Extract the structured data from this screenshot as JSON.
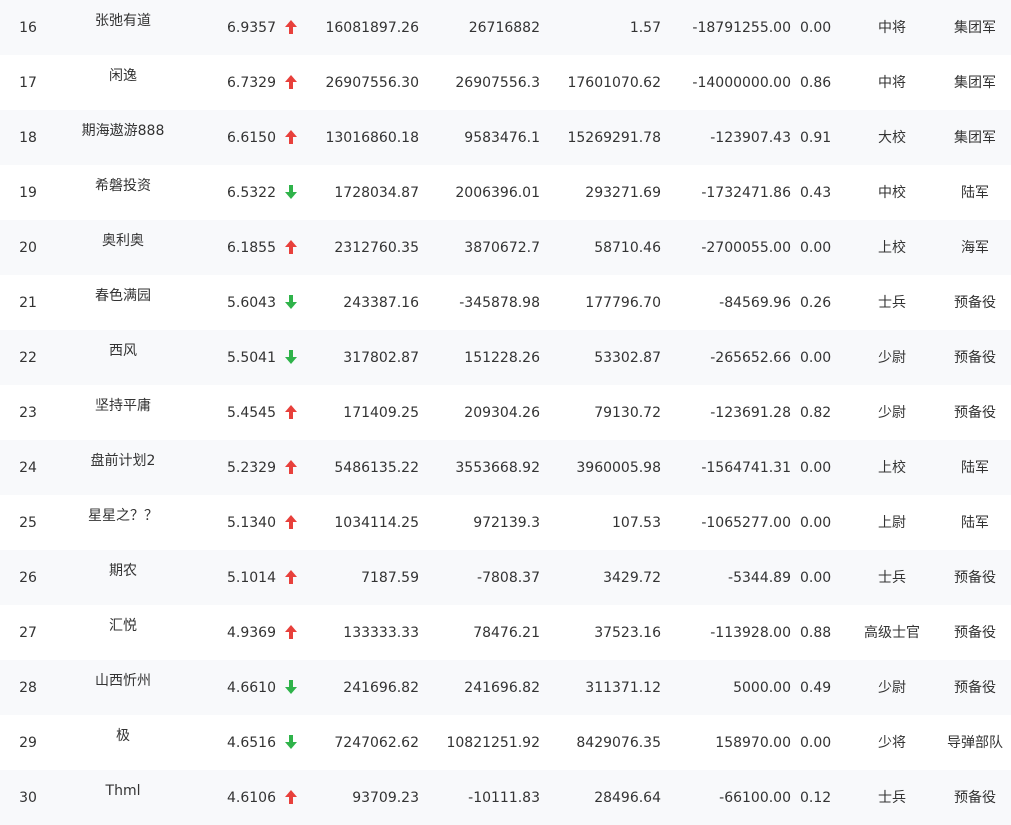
{
  "colors": {
    "up": "#e8403b",
    "down": "#2fb34a",
    "row_even": "#f8f9fb",
    "row_odd": "#ffffff",
    "text": "#333333"
  },
  "rows": [
    {
      "rank": "16",
      "name": "张弛有道",
      "score": "6.9357",
      "trend": "up",
      "v1": "16081897.26",
      "v2": "26716882",
      "v3": "1.57",
      "v4": "-18791255.00",
      "ratio": "0.00",
      "title": "中将",
      "army": "集团军"
    },
    {
      "rank": "17",
      "name": "闲逸",
      "score": "6.7329",
      "trend": "up",
      "v1": "26907556.30",
      "v2": "26907556.3",
      "v3": "17601070.62",
      "v4": "-14000000.00",
      "ratio": "0.86",
      "title": "中将",
      "army": "集团军"
    },
    {
      "rank": "18",
      "name": "期海遨游888",
      "score": "6.6150",
      "trend": "up",
      "v1": "13016860.18",
      "v2": "9583476.1",
      "v3": "15269291.78",
      "v4": "-123907.43",
      "ratio": "0.91",
      "title": "大校",
      "army": "集团军"
    },
    {
      "rank": "19",
      "name": "希磐投资",
      "score": "6.5322",
      "trend": "down",
      "v1": "1728034.87",
      "v2": "2006396.01",
      "v3": "293271.69",
      "v4": "-1732471.86",
      "ratio": "0.43",
      "title": "中校",
      "army": "陆军"
    },
    {
      "rank": "20",
      "name": "奥利奥",
      "score": "6.1855",
      "trend": "up",
      "v1": "2312760.35",
      "v2": "3870672.7",
      "v3": "58710.46",
      "v4": "-2700055.00",
      "ratio": "0.00",
      "title": "上校",
      "army": "海军"
    },
    {
      "rank": "21",
      "name": "春色满园",
      "score": "5.6043",
      "trend": "down",
      "v1": "243387.16",
      "v2": "-345878.98",
      "v3": "177796.70",
      "v4": "-84569.96",
      "ratio": "0.26",
      "title": "士兵",
      "army": "预备役"
    },
    {
      "rank": "22",
      "name": "西风",
      "score": "5.5041",
      "trend": "down",
      "v1": "317802.87",
      "v2": "151228.26",
      "v3": "53302.87",
      "v4": "-265652.66",
      "ratio": "0.00",
      "title": "少尉",
      "army": "预备役"
    },
    {
      "rank": "23",
      "name": "坚持平庸",
      "score": "5.4545",
      "trend": "up",
      "v1": "171409.25",
      "v2": "209304.26",
      "v3": "79130.72",
      "v4": "-123691.28",
      "ratio": "0.82",
      "title": "少尉",
      "army": "预备役"
    },
    {
      "rank": "24",
      "name": "盘前计划2",
      "score": "5.2329",
      "trend": "up",
      "v1": "5486135.22",
      "v2": "3553668.92",
      "v3": "3960005.98",
      "v4": "-1564741.31",
      "ratio": "0.00",
      "title": "上校",
      "army": "陆军"
    },
    {
      "rank": "25",
      "name": "星星之？？",
      "score": "5.1340",
      "trend": "up",
      "v1": "1034114.25",
      "v2": "972139.3",
      "v3": "107.53",
      "v4": "-1065277.00",
      "ratio": "0.00",
      "title": "上尉",
      "army": "陆军"
    },
    {
      "rank": "26",
      "name": "期农",
      "score": "5.1014",
      "trend": "up",
      "v1": "7187.59",
      "v2": "-7808.37",
      "v3": "3429.72",
      "v4": "-5344.89",
      "ratio": "0.00",
      "title": "士兵",
      "army": "预备役"
    },
    {
      "rank": "27",
      "name": "汇悦",
      "score": "4.9369",
      "trend": "up",
      "v1": "133333.33",
      "v2": "78476.21",
      "v3": "37523.16",
      "v4": "-113928.00",
      "ratio": "0.88",
      "title": "高级士官",
      "army": "预备役"
    },
    {
      "rank": "28",
      "name": "山西忻州",
      "score": "4.6610",
      "trend": "down",
      "v1": "241696.82",
      "v2": "241696.82",
      "v3": "311371.12",
      "v4": "5000.00",
      "ratio": "0.49",
      "title": "少尉",
      "army": "预备役"
    },
    {
      "rank": "29",
      "name": "极",
      "score": "4.6516",
      "trend": "down",
      "v1": "7247062.62",
      "v2": "10821251.92",
      "v3": "8429076.35",
      "v4": "158970.00",
      "ratio": "0.00",
      "title": "少将",
      "army": "导弹部队"
    },
    {
      "rank": "30",
      "name": "Thml",
      "score": "4.6106",
      "trend": "up",
      "v1": "93709.23",
      "v2": "-10111.83",
      "v3": "28496.64",
      "v4": "-66100.00",
      "ratio": "0.12",
      "title": "士兵",
      "army": "预备役"
    }
  ]
}
